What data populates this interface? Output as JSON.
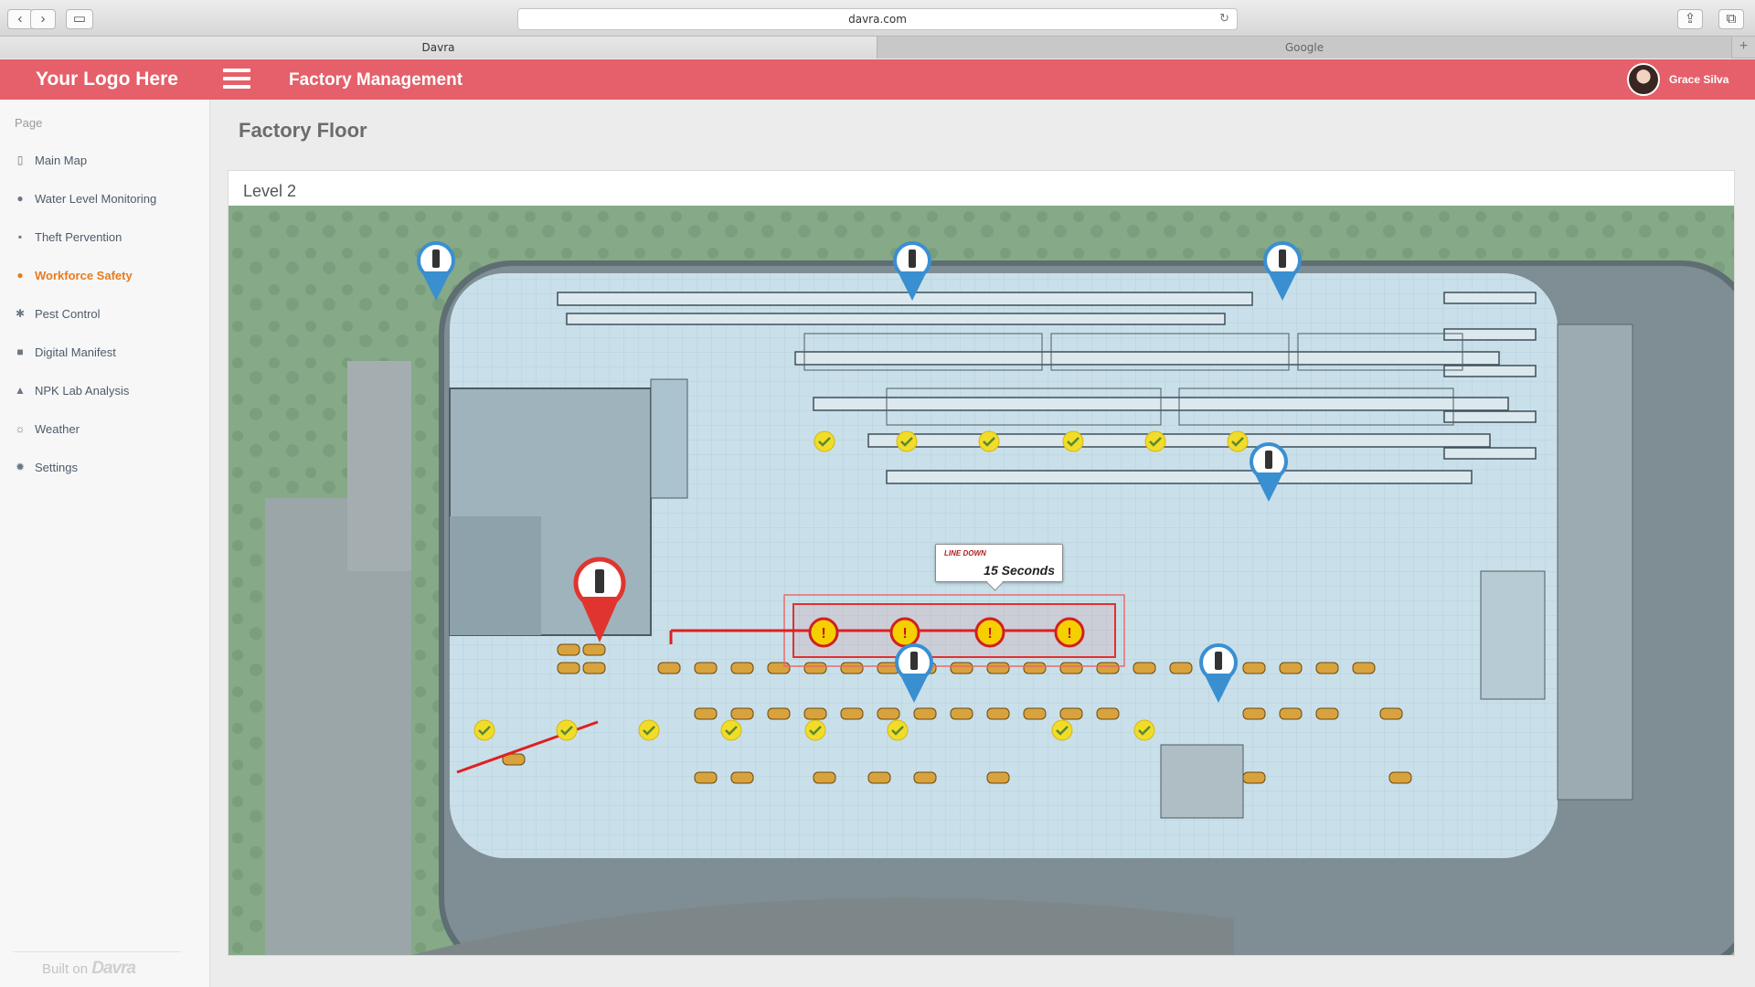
{
  "browser": {
    "url": "davra.com",
    "tabs": [
      {
        "label": "Davra",
        "active": true
      },
      {
        "label": "Google",
        "active": false
      }
    ]
  },
  "header": {
    "logo_text": "Your Logo Here",
    "app_title": "Factory Management",
    "user_name": "Grace Silva",
    "background_color": "#e5606a"
  },
  "sidebar": {
    "section_label": "Page",
    "items": [
      {
        "label": "Main Map",
        "icon": "map-icon",
        "active": false
      },
      {
        "label": "Water Level Monitoring",
        "icon": "droplet-icon",
        "active": false
      },
      {
        "label": "Theft Pervention",
        "icon": "lock-icon",
        "active": false
      },
      {
        "label": "Workforce Safety",
        "icon": "users-icon",
        "active": true
      },
      {
        "label": "Pest Control",
        "icon": "bug-icon",
        "active": false
      },
      {
        "label": "Digital Manifest",
        "icon": "truck-icon",
        "active": false
      },
      {
        "label": "NPK Lab Analysis",
        "icon": "flask-icon",
        "active": false
      },
      {
        "label": "Weather",
        "icon": "sun-icon",
        "active": false
      },
      {
        "label": "Settings",
        "icon": "gear-icon",
        "active": false
      }
    ],
    "footer_prefix": "Built on",
    "footer_brand": "Davra",
    "active_color": "#e77b20"
  },
  "main": {
    "page_title": "Factory Floor",
    "panel_title": "Level 2",
    "alert": {
      "label": "LINE DOWN",
      "value": "15 Seconds",
      "color": "#e02020"
    },
    "markers": {
      "ok_color": "#f2dc2a",
      "alert_color": "#f5d000",
      "pin_color": "#3a8fd1",
      "pin_alert_color": "#e0352f"
    }
  }
}
